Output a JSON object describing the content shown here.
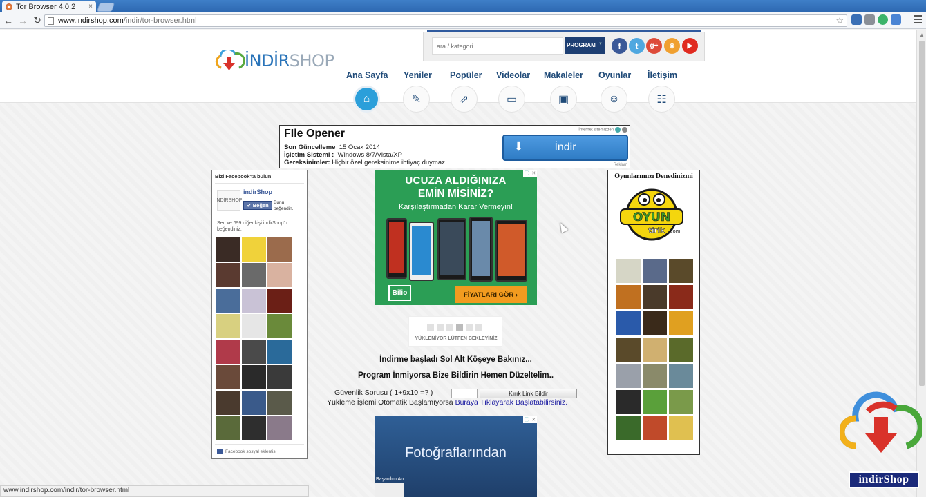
{
  "browser": {
    "tab_title": "Tor Browser 4.0.2",
    "tab_close": "×",
    "url_host": "www.indirshop.com",
    "url_path": "/indir/tor-browser.html",
    "status_url": "www.indirshop.com/indir/tor-browser.html"
  },
  "header": {
    "logo_main": "İNDİR",
    "logo_suffix": "SHOP",
    "search_placeholder": "ara / kategori",
    "program_label": "PROGRAM",
    "nav": [
      {
        "label": "Ana Sayfa",
        "icon": "home-icon"
      },
      {
        "label": "Yeniler",
        "icon": "document-icon"
      },
      {
        "label": "Popüler",
        "icon": "external-icon"
      },
      {
        "label": "Videolar",
        "icon": "video-icon"
      },
      {
        "label": "Makaleler",
        "icon": "folder-icon"
      },
      {
        "label": "Oyunlar",
        "icon": "gamepad-icon"
      },
      {
        "label": "İletişim",
        "icon": "contact-icon"
      }
    ],
    "social": [
      "f",
      "t",
      "g+",
      "rss",
      "yt"
    ]
  },
  "top_ad": {
    "title": "FIle Opener",
    "update_label": "Son Güncelleme",
    "update_value": "15 Ocak 2014",
    "os_label": "İşletim Sistemi :",
    "os_value": "Windows 8/7/Vista/XP",
    "req_label": "Gereksinimler:",
    "req_value": "Hiçbir özel gereksinime ihtiyaç duymaz",
    "button": "İndir",
    "adinfo": "İnternet sitemizden",
    "reklam": "Reklam"
  },
  "facebook": {
    "heading": "Bizi Facebook'ta bulun",
    "page_name": "indirShop",
    "like_button": "Beğen",
    "likers": "Bunu beğendin.",
    "friends_text": "Sen ve 699 diğer kişi indirShop'u beğendiniz.",
    "footer": "Facebook sosyal eklentisi",
    "logo_text": "İNDİRSHOP"
  },
  "center_ad": {
    "line1": "UCUZA ALDIĞINIZA",
    "line2": "EMİN MİSİNİZ?",
    "line3": "Karşılaştırmadan Karar Vermeyin!",
    "brand": "Bilio",
    "button": "FİYATLARI GÖR ›"
  },
  "loader_text": "YÜKLENİYOR LÜTFEN BEKLEYİNİZ",
  "messages": {
    "download_started": "İndirme başladı Sol Alt Köşeye Bakınız...",
    "not_downloading": "Program İnmiyorsa Bize Bildirin Hemen Düzeltelim..",
    "security_question": "Güvenlik Sorusu ( 1+9x10 =? )",
    "broken_link_button": "Kırık Link Bildir",
    "auto_start_prefix": "Yükleme İşlemi Otomatik Başlamıyorsa",
    "auto_start_link": "Buraya Tıklayarak Başlatabilirsiniz."
  },
  "bottom_ad": {
    "headline": "Fotoğraflarından",
    "small": "Başardım An"
  },
  "games": {
    "heading": "Oyunlarımızı Denedinizmi",
    "logo_line1": "OYUN",
    "logo_line2": "tirik",
    "logo_line3": ".com"
  },
  "watermark": "indirShop"
}
